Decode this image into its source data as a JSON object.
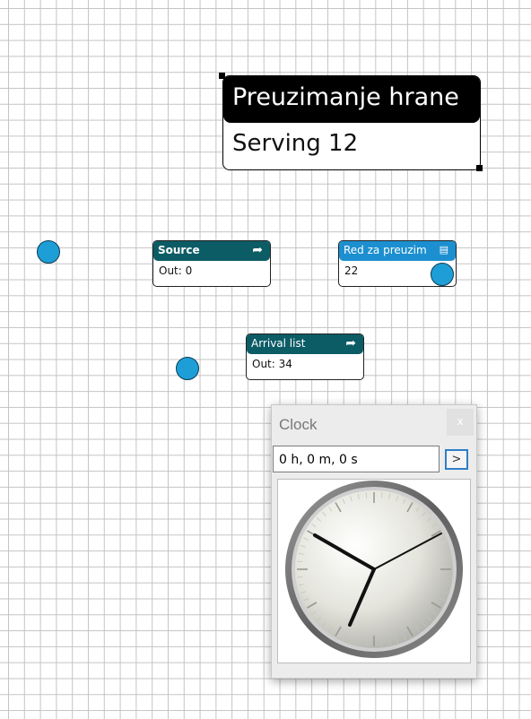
{
  "title_box": {
    "title": "Preuzimanje hrane",
    "subtitle": "Serving 12"
  },
  "blocks": {
    "source": {
      "title": "Source",
      "value": "Out: 0",
      "color": "#0c5c66"
    },
    "queue": {
      "title": "Red za preuzim",
      "value": "22",
      "color": "#1c8fd0"
    },
    "arrival": {
      "title": "Arrival list",
      "value": "Out: 34",
      "color": "#0c5c66"
    }
  },
  "clock": {
    "title": "Clock",
    "close": "x",
    "time_value": "0 h, 0 m, 0 s",
    "go_label": ">"
  },
  "colors": {
    "dot": "#1e9ed6",
    "grid": "#c4c4c4"
  }
}
